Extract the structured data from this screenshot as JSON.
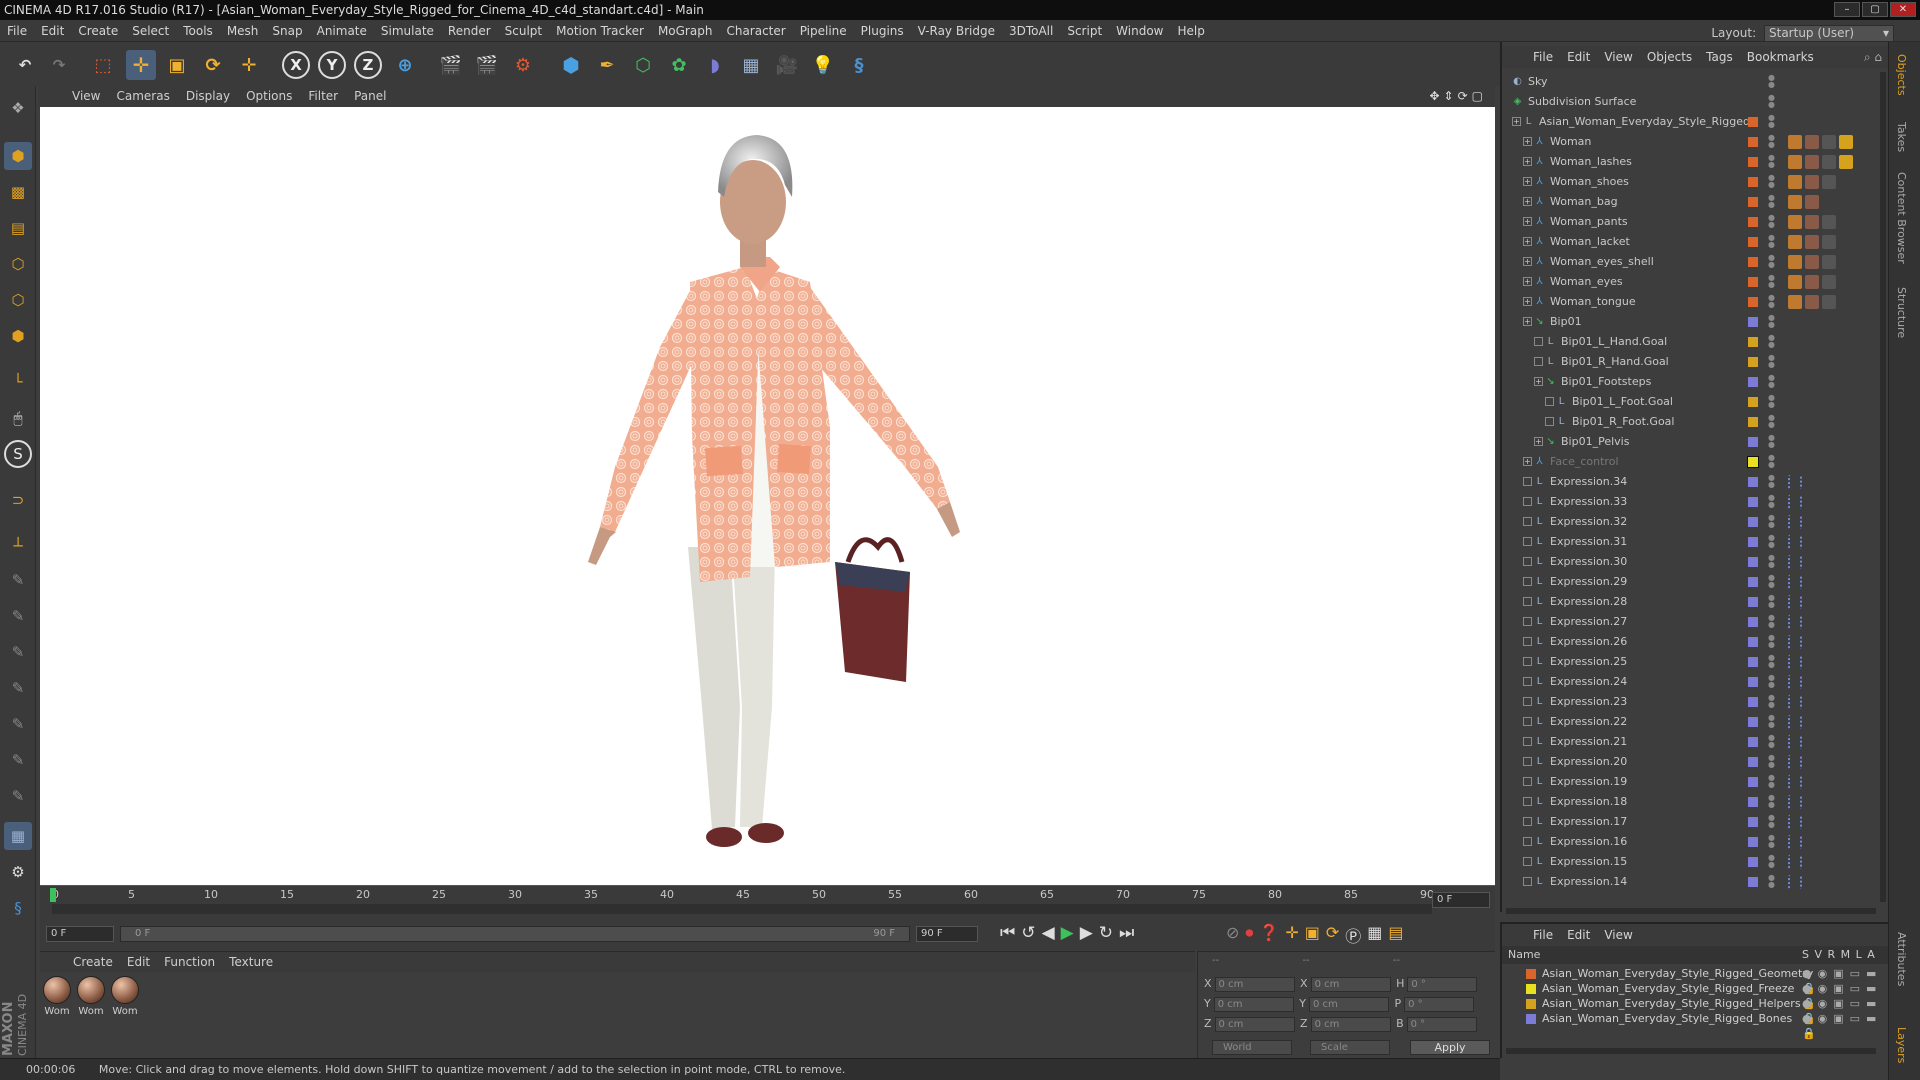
{
  "window": {
    "title": "CINEMA 4D R17.016 Studio (R17) - [Asian_Woman_Everyday_Style_Rigged_for_Cinema_4D_c4d_standart.c4d] - Main",
    "controls": [
      "–",
      "▢",
      "✕"
    ]
  },
  "menubar": {
    "items": [
      "File",
      "Edit",
      "Create",
      "Select",
      "Tools",
      "Mesh",
      "Snap",
      "Animate",
      "Simulate",
      "Render",
      "Sculpt",
      "Motion Tracker",
      "MoGraph",
      "Character",
      "Pipeline",
      "Plugins",
      "V-Ray Bridge",
      "3DToAll",
      "Script",
      "Window",
      "Help"
    ],
    "layout_label": "Layout:",
    "layout_value": "Startup (User)"
  },
  "toolbar": {
    "axis_x": "X",
    "axis_y": "Y",
    "axis_z": "Z"
  },
  "viewport": {
    "menu": [
      "View",
      "Cameras",
      "Display",
      "Options",
      "Filter",
      "Panel"
    ]
  },
  "timeline": {
    "ticks": [
      "0",
      "5",
      "10",
      "15",
      "20",
      "25",
      "30",
      "35",
      "40",
      "45",
      "50",
      "55",
      "60",
      "65",
      "70",
      "75",
      "80",
      "85",
      "90"
    ],
    "current_frame": "0 F",
    "start_field": "0 F",
    "range_start": "0 F",
    "range_end": "90 F",
    "end_field": "90 F"
  },
  "materials": {
    "menu": [
      "Create",
      "Edit",
      "Function",
      "Texture"
    ],
    "items": [
      "Wom",
      "Wom",
      "Wom"
    ]
  },
  "coordinates": {
    "header": [
      "--",
      "--",
      "--"
    ],
    "rows": [
      {
        "a": "X",
        "av": "0 cm",
        "b": "X",
        "bv": "0 cm",
        "c": "H",
        "cv": "0 °"
      },
      {
        "a": "Y",
        "av": "0 cm",
        "b": "Y",
        "bv": "0 cm",
        "c": "P",
        "cv": "0 °"
      },
      {
        "a": "Z",
        "av": "0 cm",
        "b": "Z",
        "bv": "0 cm",
        "c": "B",
        "cv": "0 °"
      }
    ],
    "mode1": "World",
    "mode2": "Scale",
    "apply": "Apply"
  },
  "status": {
    "time": "00:00:06",
    "message": "Move: Click and drag to move elements. Hold down SHIFT to quantize movement / add to the selection in point mode, CTRL to remove."
  },
  "objects": {
    "menu": [
      "File",
      "Edit",
      "View",
      "Objects",
      "Tags",
      "Bookmarks"
    ],
    "rows": [
      {
        "name": "Sky",
        "indent": 0,
        "icon": "sky",
        "color": "#3d3d3d",
        "tags": 0
      },
      {
        "name": "Subdivision Surface",
        "indent": 0,
        "icon": "subd",
        "color": "#3d3d3d",
        "tags": 0
      },
      {
        "name": "Asian_Woman_Everyday_Style_Rigged",
        "indent": 1,
        "icon": "null",
        "color": "#d9652b",
        "tags": 0
      },
      {
        "name": "Woman",
        "indent": 2,
        "icon": "bone",
        "color": "#d9652b",
        "tags": 4
      },
      {
        "name": "Woman_lashes",
        "indent": 2,
        "icon": "bone",
        "color": "#d9652b",
        "tags": 4
      },
      {
        "name": "Woman_shoes",
        "indent": 2,
        "icon": "bone",
        "color": "#d9652b",
        "tags": 3
      },
      {
        "name": "Woman_bag",
        "indent": 2,
        "icon": "bone",
        "color": "#d9652b",
        "tags": 2
      },
      {
        "name": "Woman_pants",
        "indent": 2,
        "icon": "bone",
        "color": "#d9652b",
        "tags": 3
      },
      {
        "name": "Woman_lacket",
        "indent": 2,
        "icon": "bone",
        "color": "#d9652b",
        "tags": 3
      },
      {
        "name": "Woman_eyes_shell",
        "indent": 2,
        "icon": "bone",
        "color": "#d9652b",
        "tags": 3
      },
      {
        "name": "Woman_eyes",
        "indent": 2,
        "icon": "bone",
        "color": "#d9652b",
        "tags": 3
      },
      {
        "name": "Woman_tongue",
        "indent": 2,
        "icon": "bone",
        "color": "#d9652b",
        "tags": 3
      },
      {
        "name": "Bip01",
        "indent": 2,
        "icon": "bip",
        "color": "#7c7cd6",
        "tags": 0
      },
      {
        "name": "Bip01_L_Hand.Goal",
        "indent": 3,
        "icon": "null",
        "color": "#d4a21c",
        "tags": 0
      },
      {
        "name": "Bip01_R_Hand.Goal",
        "indent": 3,
        "icon": "null",
        "color": "#d4a21c",
        "tags": 0
      },
      {
        "name": "Bip01_Footsteps",
        "indent": 3,
        "icon": "bip",
        "color": "#7c7cd6",
        "tags": 0
      },
      {
        "name": "Bip01_L_Foot.Goal",
        "indent": 4,
        "icon": "null",
        "color": "#d4a21c",
        "tags": 0
      },
      {
        "name": "Bip01_R_Foot.Goal",
        "indent": 4,
        "icon": "null",
        "color": "#d4a21c",
        "tags": 0
      },
      {
        "name": "Bip01_Pelvis",
        "indent": 3,
        "icon": "bip",
        "color": "#7c7cd6",
        "tags": 0
      },
      {
        "name": "Face_control",
        "indent": 2,
        "icon": "bone",
        "color": "#e8e020",
        "tags": 0,
        "dim": true
      },
      {
        "name": "Expression.34",
        "indent": 2,
        "icon": "null",
        "color": "#7c7cd6",
        "tags": 1
      },
      {
        "name": "Expression.33",
        "indent": 2,
        "icon": "null",
        "color": "#7c7cd6",
        "tags": 1
      },
      {
        "name": "Expression.32",
        "indent": 2,
        "icon": "null",
        "color": "#7c7cd6",
        "tags": 1
      },
      {
        "name": "Expression.31",
        "indent": 2,
        "icon": "null",
        "color": "#7c7cd6",
        "tags": 1
      },
      {
        "name": "Expression.30",
        "indent": 2,
        "icon": "null",
        "color": "#7c7cd6",
        "tags": 1
      },
      {
        "name": "Expression.29",
        "indent": 2,
        "icon": "null",
        "color": "#7c7cd6",
        "tags": 1
      },
      {
        "name": "Expression.28",
        "indent": 2,
        "icon": "null",
        "color": "#7c7cd6",
        "tags": 1
      },
      {
        "name": "Expression.27",
        "indent": 2,
        "icon": "null",
        "color": "#7c7cd6",
        "tags": 1
      },
      {
        "name": "Expression.26",
        "indent": 2,
        "icon": "null",
        "color": "#7c7cd6",
        "tags": 1
      },
      {
        "name": "Expression.25",
        "indent": 2,
        "icon": "null",
        "color": "#7c7cd6",
        "tags": 1
      },
      {
        "name": "Expression.24",
        "indent": 2,
        "icon": "null",
        "color": "#7c7cd6",
        "tags": 1
      },
      {
        "name": "Expression.23",
        "indent": 2,
        "icon": "null",
        "color": "#7c7cd6",
        "tags": 1
      },
      {
        "name": "Expression.22",
        "indent": 2,
        "icon": "null",
        "color": "#7c7cd6",
        "tags": 1
      },
      {
        "name": "Expression.21",
        "indent": 2,
        "icon": "null",
        "color": "#7c7cd6",
        "tags": 1
      },
      {
        "name": "Expression.20",
        "indent": 2,
        "icon": "null",
        "color": "#7c7cd6",
        "tags": 1
      },
      {
        "name": "Expression.19",
        "indent": 2,
        "icon": "null",
        "color": "#7c7cd6",
        "tags": 1
      },
      {
        "name": "Expression.18",
        "indent": 2,
        "icon": "null",
        "color": "#7c7cd6",
        "tags": 1
      },
      {
        "name": "Expression.17",
        "indent": 2,
        "icon": "null",
        "color": "#7c7cd6",
        "tags": 1
      },
      {
        "name": "Expression.16",
        "indent": 2,
        "icon": "null",
        "color": "#7c7cd6",
        "tags": 1
      },
      {
        "name": "Expression.15",
        "indent": 2,
        "icon": "null",
        "color": "#7c7cd6",
        "tags": 1
      },
      {
        "name": "Expression.14",
        "indent": 2,
        "icon": "null",
        "color": "#7c7cd6",
        "tags": 1
      }
    ]
  },
  "layers": {
    "menu": [
      "File",
      "Edit",
      "View"
    ],
    "header_name": "Name",
    "header_cols": "S  V  R  M  L  A",
    "rows": [
      {
        "name": "Asian_Woman_Everyday_Style_Rigged_Geometry",
        "color": "#d9652b"
      },
      {
        "name": "Asian_Woman_Everyday_Style_Rigged_Freeze",
        "color": "#e8e020"
      },
      {
        "name": "Asian_Woman_Everyday_Style_Rigged_Helpers",
        "color": "#d4a21c"
      },
      {
        "name": "Asian_Woman_Everyday_Style_Rigged_Bones",
        "color": "#7c7cd6"
      }
    ]
  },
  "side_tabs": [
    "Objects",
    "Takes",
    "Content Browser",
    "Structure",
    "Attributes",
    "Layers"
  ],
  "brand": {
    "line1": "MAXON",
    "line2": "CINEMA 4D"
  }
}
